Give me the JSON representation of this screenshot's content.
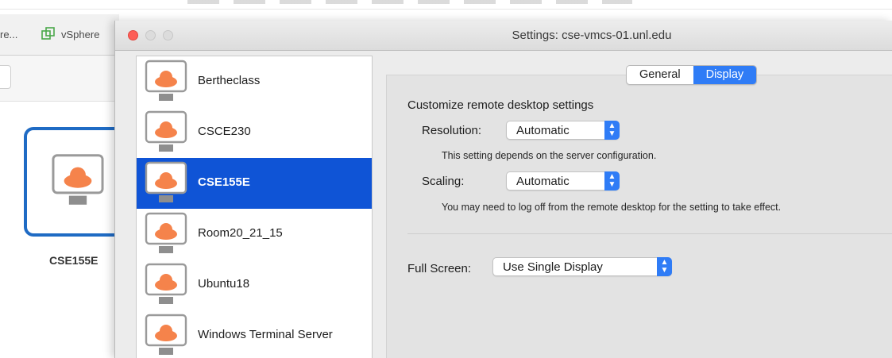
{
  "background_app": {
    "tab_truncated": "re...",
    "tab_vsphere": "vSphere",
    "tile_label": "CSE155E"
  },
  "window": {
    "title": "Settings: cse-vmcs-01.unl.edu"
  },
  "sidebar": {
    "items": [
      {
        "label": "Bertheclass",
        "selected": false
      },
      {
        "label": "CSCE230",
        "selected": false
      },
      {
        "label": "CSE155E",
        "selected": true
      },
      {
        "label": "Room20_21_15",
        "selected": false
      },
      {
        "label": "Ubuntu18",
        "selected": false
      },
      {
        "label": "Windows Terminal Server",
        "selected": false
      }
    ]
  },
  "tabs": {
    "general": "General",
    "display": "Display",
    "active": "Display"
  },
  "display": {
    "heading": "Customize remote desktop settings",
    "resolution_label": "Resolution:",
    "resolution_value": "Automatic",
    "resolution_note": "This setting depends on the server configuration.",
    "scaling_label": "Scaling:",
    "scaling_value": "Automatic",
    "scaling_note": "You may need to log off from the remote desktop for the setting to take effect.",
    "fullscreen_label": "Full Screen:",
    "fullscreen_value": "Use Single Display"
  },
  "icons": {
    "desktop": "monitor-cloud-icon",
    "vsphere": "vsphere-icon",
    "popup": "chevron-updown-icon"
  },
  "colors": {
    "selection": "#0f54d6",
    "accent": "#2f7cf6",
    "cloud": "#f5834b",
    "close_button": "#fd5e57"
  }
}
